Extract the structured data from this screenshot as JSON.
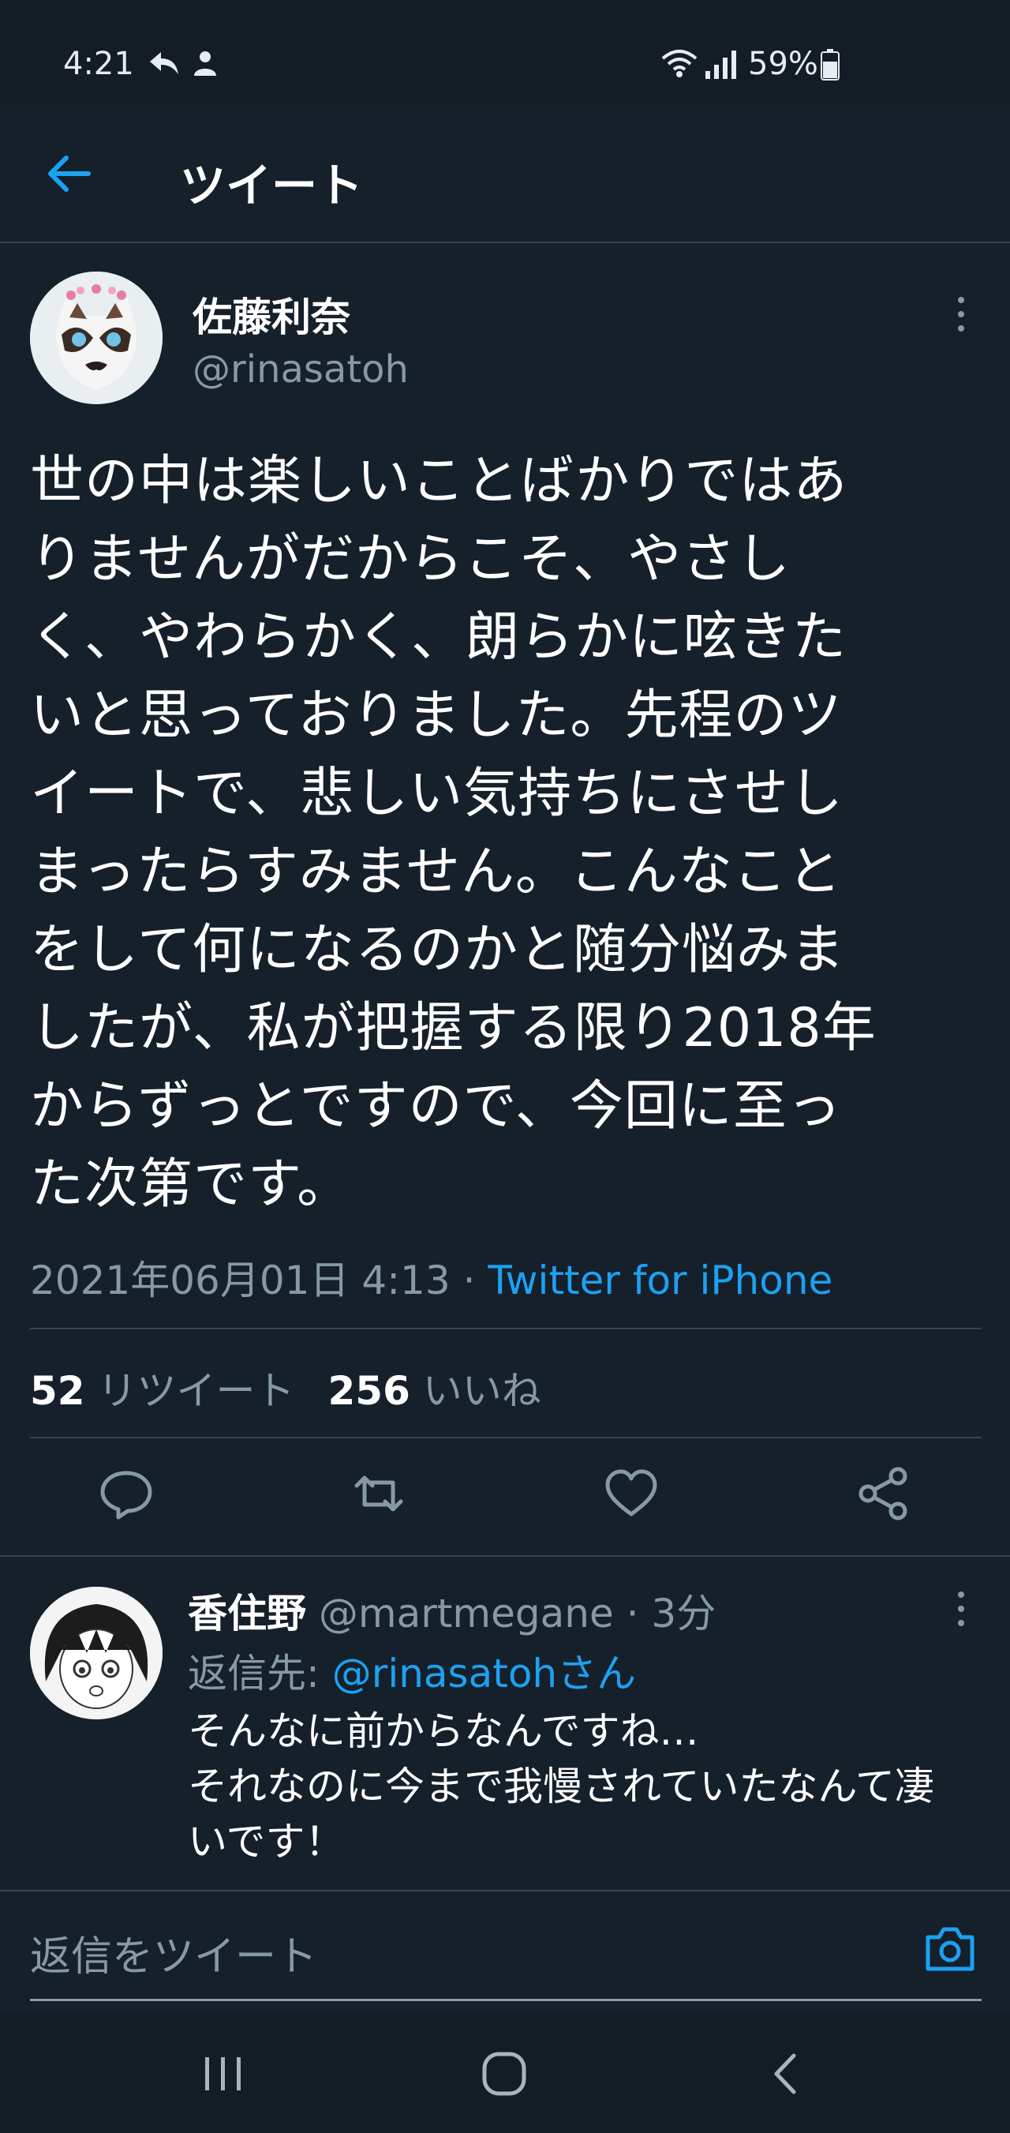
{
  "status_bar": {
    "time": "4:21",
    "battery": "59%",
    "icons": [
      "reply-arrow-icon",
      "person-icon",
      "wifi-icon",
      "signal-icon",
      "battery-icon"
    ]
  },
  "header": {
    "title": "ツイート",
    "back_icon": "arrow-left-icon"
  },
  "tweet": {
    "author_name": "佐藤利奈",
    "author_handle": "@rinasatoh",
    "text_lines": [
      "世の中は楽しいことばかりではあ",
      "りませんがだからこそ、やさし",
      "く、やわらかく、朗らかに呟きた",
      "いと思っておりました。先程のツ",
      "イートで、悲しい気持ちにさせし",
      "まったらすみません。こんなこと",
      "をして何になるのかと随分悩みま",
      "したが、私が把握する限り2018年",
      "からずっとですので、今回に至っ",
      "た次第です。"
    ],
    "timestamp": "2021年06月01日 4:13",
    "separator": "·",
    "source": "Twitter for iPhone",
    "retweets": "52",
    "retweets_label": "リツイート",
    "likes": "256",
    "likes_label": "いいね"
  },
  "actions": [
    "reply-icon",
    "retweet-icon",
    "like-icon",
    "share-icon"
  ],
  "reply": {
    "name": "香住野",
    "handle": "@martmegane",
    "time": "· 3分",
    "reply_to_label": "返信先:",
    "reply_to_handle": "@rinasatohさん",
    "text_lines": [
      "そんなに前からなんですね…",
      "それなのに今まで我慢されていたなんて凄",
      "いです！"
    ]
  },
  "compose": {
    "placeholder": "返信をツイート",
    "icon": "camera-icon"
  },
  "navbar": {
    "icons": [
      "recent-apps-icon",
      "home-icon",
      "back-icon"
    ]
  },
  "colors": {
    "background": "#15202b",
    "accent": "#1da1f2",
    "muted": "#8899a6",
    "divider": "#38444d"
  }
}
